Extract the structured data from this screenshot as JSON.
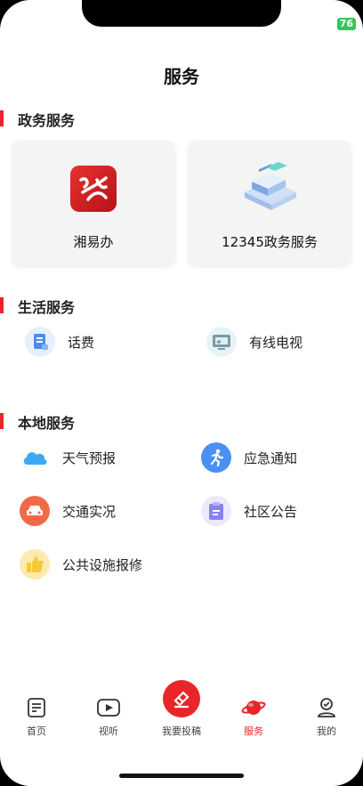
{
  "status": {
    "battery": "76"
  },
  "page": {
    "title": "服务"
  },
  "gov_section": {
    "title": "政务服务",
    "cards": [
      {
        "label": "湘易办",
        "icon": "xiangyiban-logo-icon"
      },
      {
        "label": "12345政务服务",
        "icon": "server-stack-icon"
      }
    ]
  },
  "life_section": {
    "title": "生活服务",
    "items": [
      {
        "label": "话费",
        "icon": "phone-bill-icon",
        "color": "#4a8df0"
      },
      {
        "label": "有线电视",
        "icon": "tv-icon",
        "color": "#7a9aa6"
      }
    ]
  },
  "local_section": {
    "title": "本地服务",
    "items": [
      {
        "label": "天气预报",
        "icon": "cloud-icon",
        "color": "#3fa8f5"
      },
      {
        "label": "应急通知",
        "icon": "running-person-icon",
        "color": "#4a90f0"
      },
      {
        "label": "交通实况",
        "icon": "car-icon",
        "color": "#f06a4a"
      },
      {
        "label": "社区公告",
        "icon": "clipboard-icon",
        "color": "#8a82ee"
      },
      {
        "label": "公共设施报修",
        "icon": "thumbs-up-icon",
        "color": "#f6c83a"
      }
    ]
  },
  "tabbar": {
    "tabs": [
      {
        "label": "首页",
        "icon": "document-icon"
      },
      {
        "label": "视听",
        "icon": "play-icon"
      },
      {
        "label": "我要投稿",
        "icon": "submit-icon"
      },
      {
        "label": "服务",
        "icon": "planet-icon",
        "active": true
      },
      {
        "label": "我的",
        "icon": "user-icon"
      }
    ],
    "active_color": "#e8262a"
  }
}
